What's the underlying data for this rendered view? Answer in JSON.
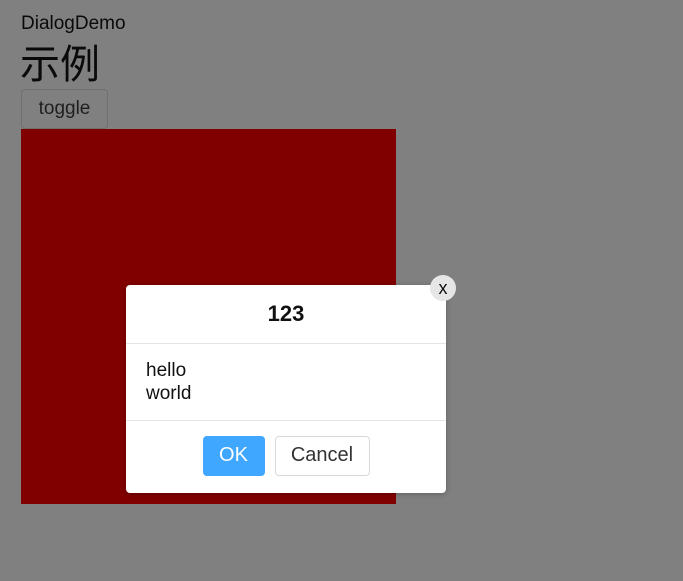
{
  "page": {
    "label": "DialogDemo",
    "heading": "示例",
    "toggle_label": "toggle"
  },
  "dialog": {
    "title": "123",
    "body_lines": [
      "hello",
      "world"
    ],
    "ok_label": "OK",
    "cancel_label": "Cancel",
    "close_label": "x"
  },
  "colors": {
    "overlay": "#808080",
    "box": "#800000",
    "primary": "#3fa7ff"
  }
}
